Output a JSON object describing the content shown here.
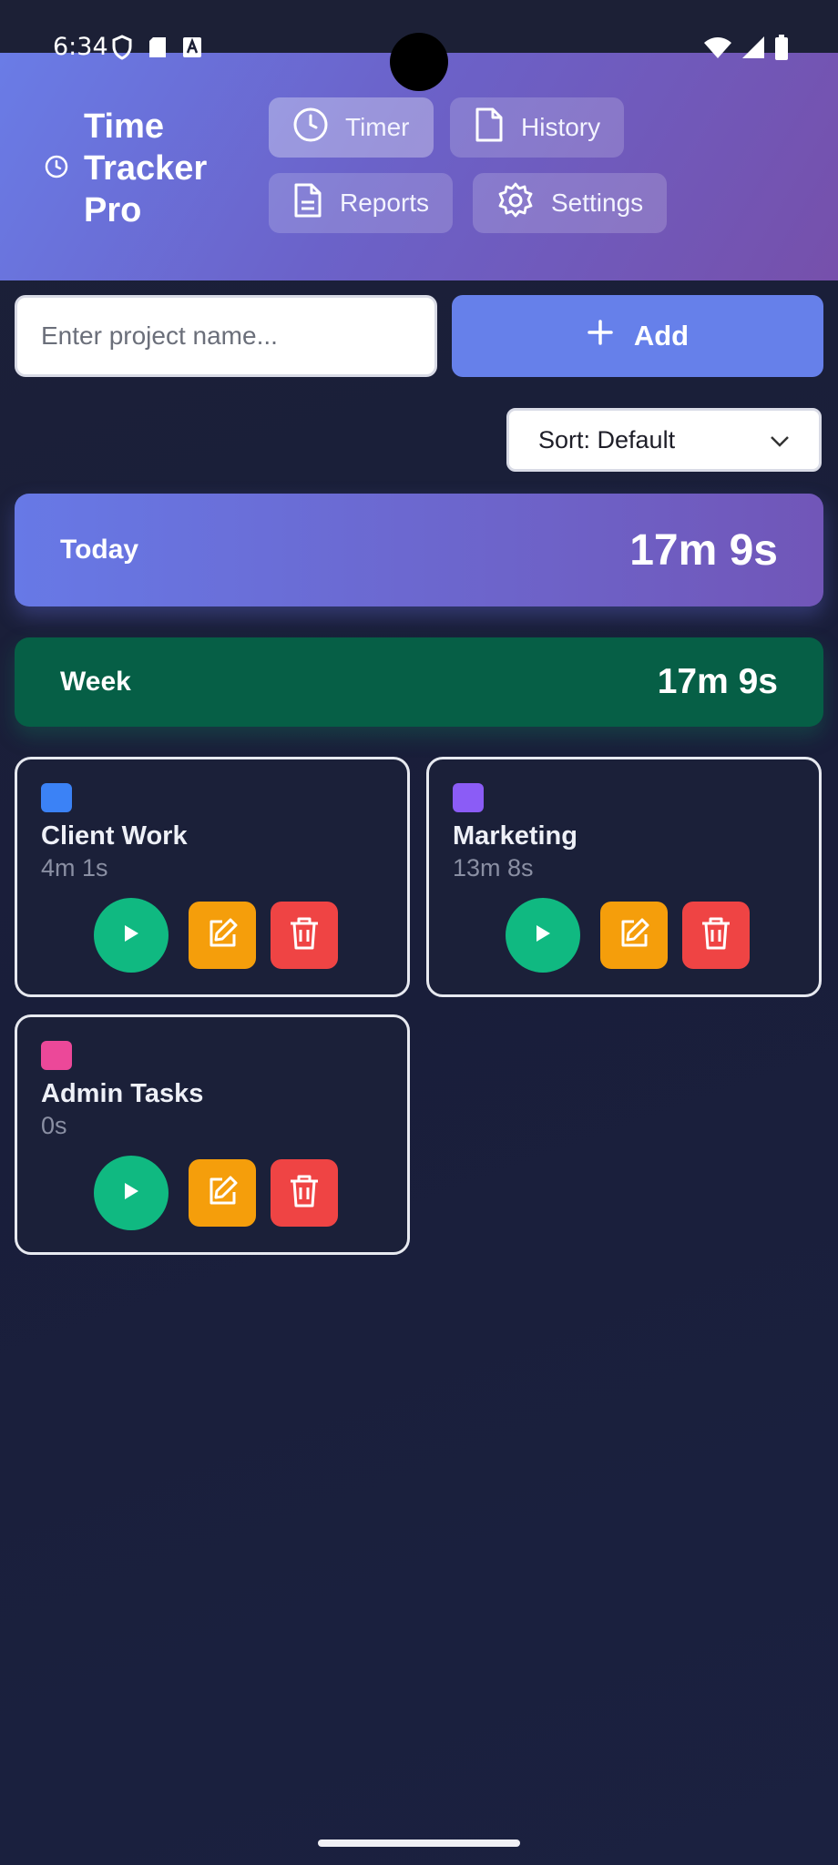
{
  "status_bar": {
    "time": "6:34"
  },
  "header": {
    "app_title": "Time Tracker Pro",
    "nav": [
      {
        "label": "Timer",
        "icon": "clock-icon",
        "active": true
      },
      {
        "label": "History",
        "icon": "file-icon",
        "active": false
      },
      {
        "label": "Reports",
        "icon": "document-icon",
        "active": false
      },
      {
        "label": "Settings",
        "icon": "gear-icon",
        "active": false
      }
    ]
  },
  "project_form": {
    "input_placeholder": "Enter project name...",
    "input_value": "",
    "add_label": "Add"
  },
  "sort": {
    "selected": "Sort: Default"
  },
  "summary": {
    "today_label": "Today",
    "today_value": "17m 9s",
    "week_label": "Week",
    "week_value": "17m 9s"
  },
  "projects": [
    {
      "name": "Client Work",
      "time": "4m 1s",
      "color": "#3b82f6"
    },
    {
      "name": "Marketing",
      "time": "13m 8s",
      "color": "#8b5cf6"
    },
    {
      "name": "Admin Tasks",
      "time": "0s",
      "color": "#ec4899"
    }
  ],
  "colors": {
    "play": "#10b981",
    "edit": "#f59e0b",
    "delete": "#ef4444",
    "accent": "#6680ea",
    "week_bg": "#065f46"
  }
}
